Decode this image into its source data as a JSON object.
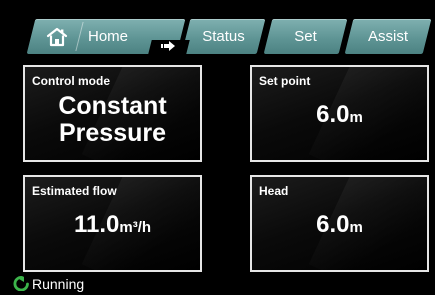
{
  "tabs": {
    "home": "Home",
    "status": "Status",
    "set": "Set",
    "assist": "Assist"
  },
  "panels": {
    "control_mode": {
      "title": "Control mode",
      "line1": "Constant",
      "line2": "Pressure"
    },
    "set_point": {
      "title": "Set point",
      "value": "6.0",
      "unit": "m"
    },
    "estimated_flow": {
      "title": "Estimated flow",
      "value": "11.0",
      "unit": "m³/h"
    },
    "head": {
      "title": "Head",
      "value": "6.0",
      "unit": "m"
    }
  },
  "status": {
    "text": "Running",
    "color": "#3cb44b"
  },
  "colors": {
    "tab": "#5f9595",
    "panel_border": "#e6e6e6"
  },
  "icons": {
    "home": "home-icon",
    "arrow": "arrow-right-icon",
    "status": "running-icon"
  }
}
